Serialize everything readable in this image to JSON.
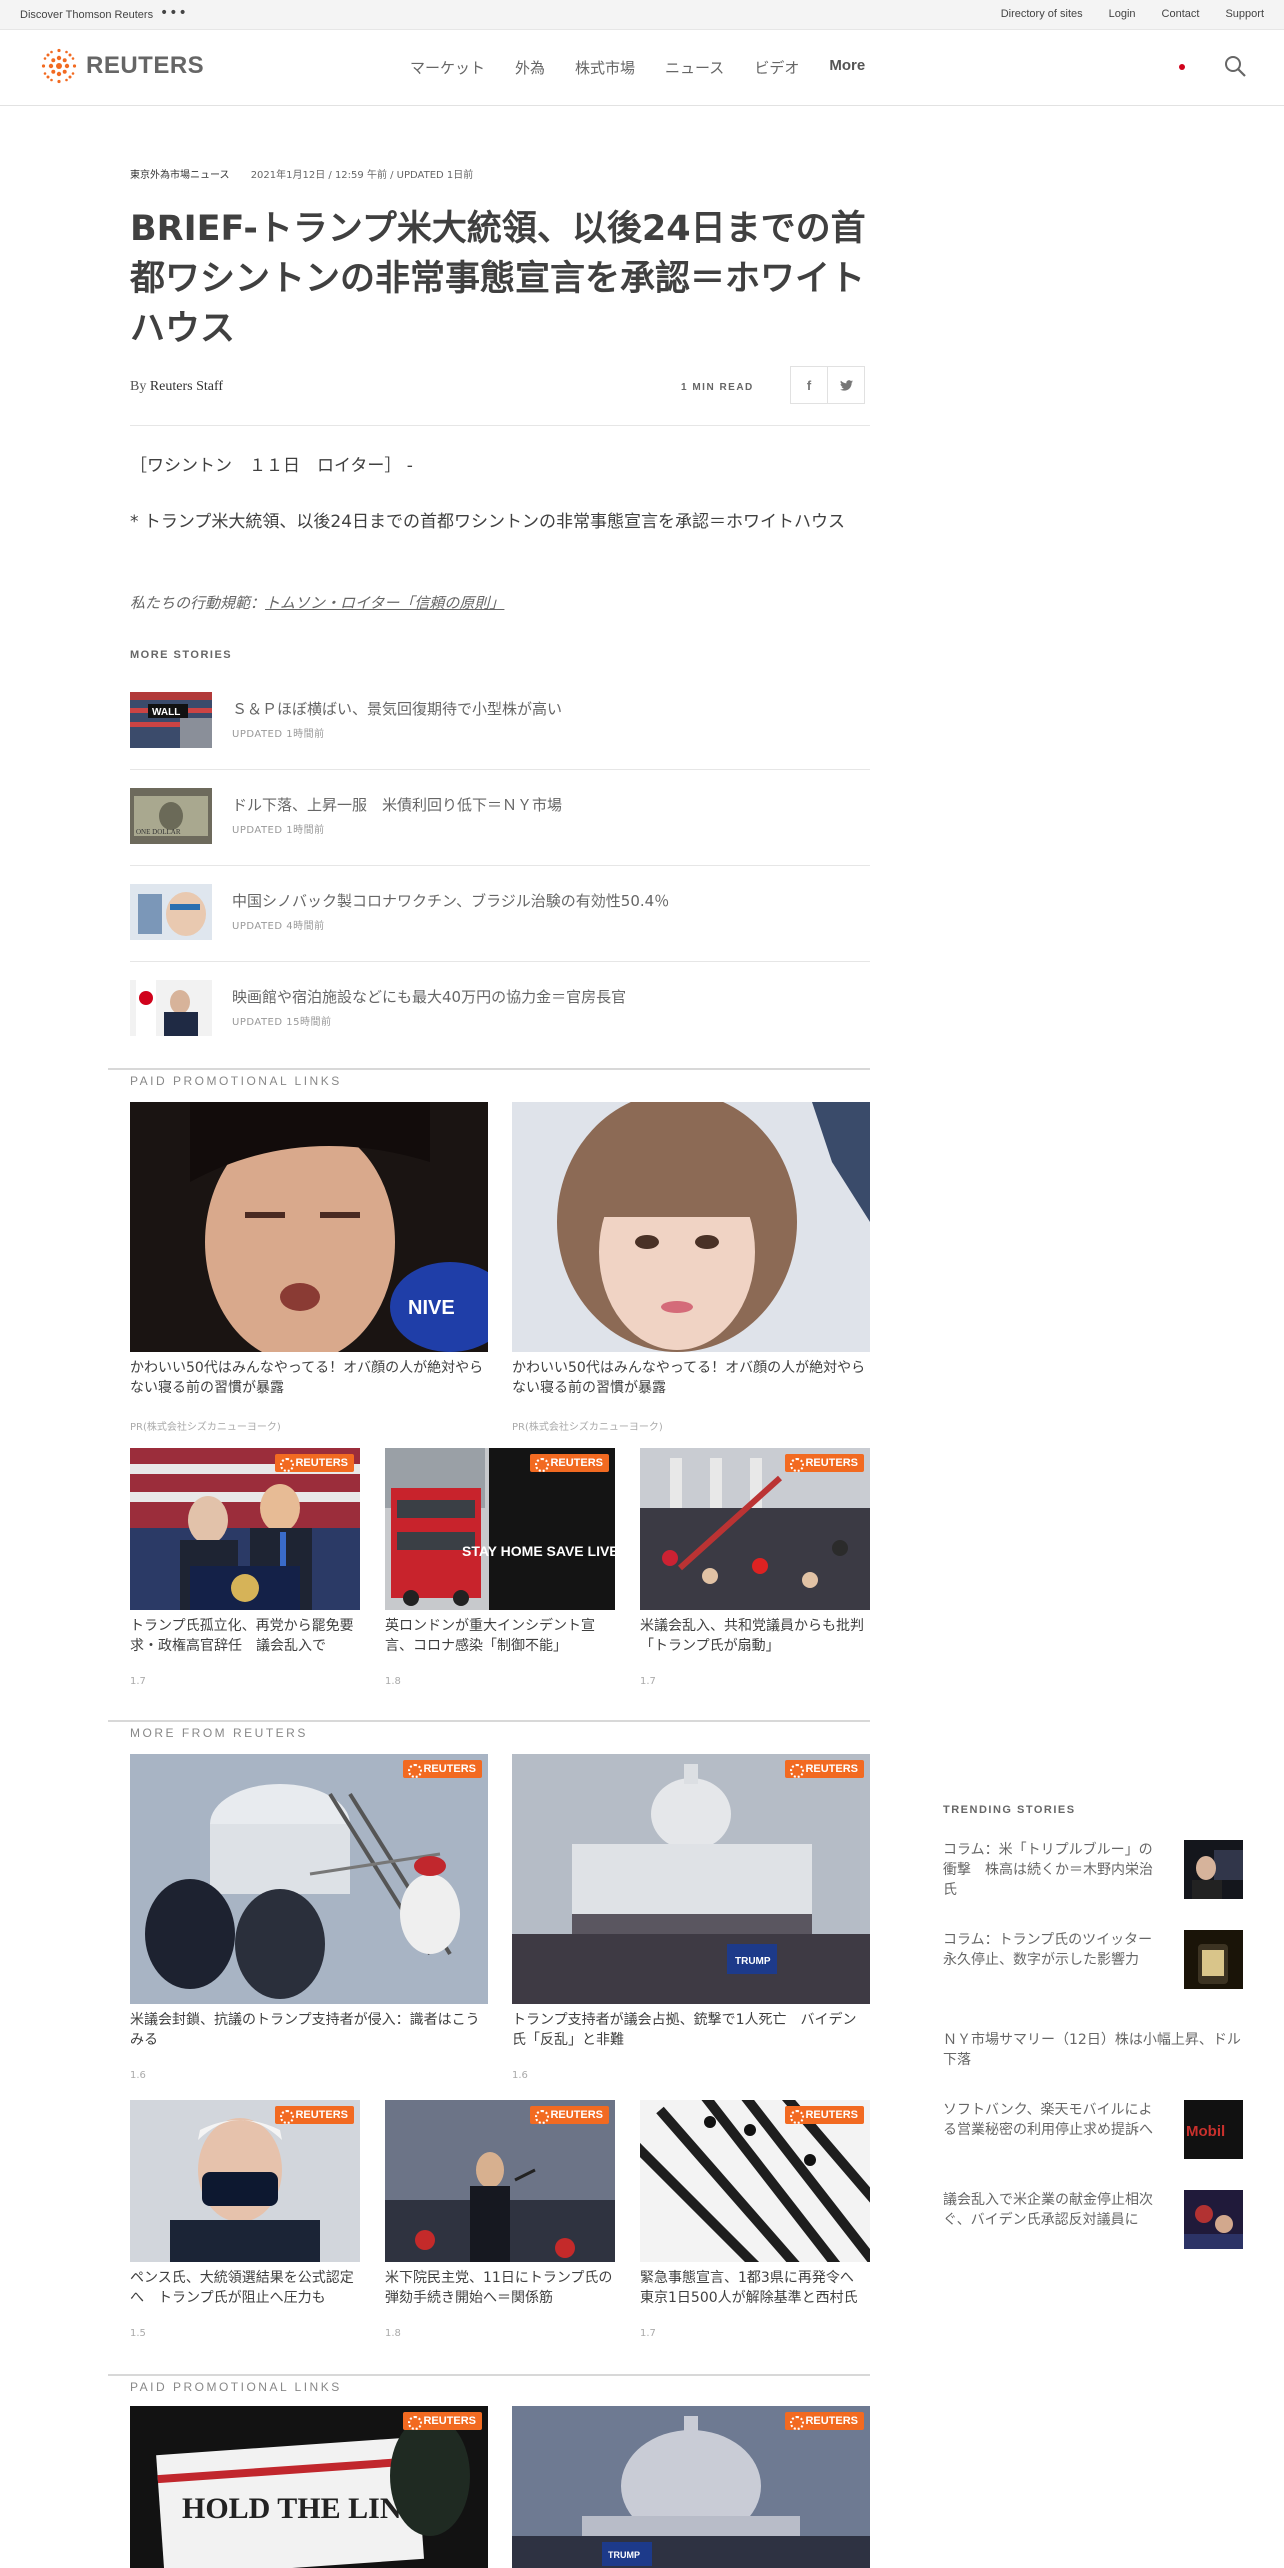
{
  "utility": {
    "discover": "Discover Thomson Reuters",
    "dots": "•••",
    "links": [
      "Directory of sites",
      "Login",
      "Contact",
      "Support"
    ]
  },
  "header": {
    "logo_text": "REUTERS",
    "nav": [
      "マーケット",
      "外為",
      "株式市場",
      "ニュース",
      "ビデオ"
    ],
    "nav_more": "More"
  },
  "article": {
    "section": "東京外為市場ニュース",
    "dateline": "2021年1月12日 / 12:59 午前 / UPDATED 1日前",
    "headline": "BRIEF-トランプ米大統領、以後24日までの首都ワシントンの非常事態宣言を承認＝ホワイトハウス",
    "by_prefix": "By",
    "author": "Reuters Staff",
    "read_time": "1 MIN READ",
    "share_fb": "f",
    "share_tw": "t",
    "para1": "［ワシントン　１１日　ロイター］ -",
    "para2": "* トランプ米大統領、以後24日までの首都ワシントンの非常事態宣言を承認＝ホワイトハウス",
    "conduct_prefix": "私たちの行動規範：",
    "conduct_link": "トムソン・ロイター「信頼の原則」"
  },
  "more_stories": {
    "label": "MORE STORIES",
    "items": [
      {
        "title": "Ｓ＆Ｐほぼ横ばい、景気回復期待で小型株が高い",
        "time": "UPDATED 1時間前",
        "thumb_label": "WALL"
      },
      {
        "title": "ドル下落、上昇一服　米債利回り低下＝ＮＹ市場",
        "time": "UPDATED 1時間前",
        "thumb_label": "ONE DOLLAR"
      },
      {
        "title": "中国シノバック製コロナワクチン、ブラジル治験の有効性50.4％",
        "time": "UPDATED 4時間前",
        "thumb_label": ""
      },
      {
        "title": "映画館や宿泊施設などにも最大40万円の協力金＝官房長官",
        "time": "UPDATED 15時間前",
        "thumb_label": ""
      }
    ]
  },
  "promo1": {
    "label": "PAID PROMOTIONAL LINKS",
    "big": [
      {
        "caption": "かわいい50代はみんなやってる！オバ顔の人が絶対やらない寝る前の習慣が暴露",
        "source": "PR(株式会社シズカニューヨーク)",
        "img_text": "NIVE"
      },
      {
        "caption": "かわいい50代はみんなやってる！オバ顔の人が絶対やらない寝る前の習慣が暴露",
        "source": "PR(株式会社シズカニューヨーク)",
        "img_text": ""
      }
    ],
    "small": [
      {
        "caption": "トランプ氏孤立化、再党から罷免要求・政権高官辞任　議会乱入で",
        "date": "1.7",
        "badge": "REUTERS",
        "img_text": ""
      },
      {
        "caption": "英ロンドンが重大インシデント宣言、コロナ感染「制御不能」",
        "date": "1.8",
        "badge": "REUTERS",
        "img_text": "STAY HOME SAVE LIVES"
      },
      {
        "caption": "米議会乱入、共和党議員からも批判　「トランプ氏が扇動」",
        "date": "1.7",
        "badge": "REUTERS",
        "img_text": ""
      }
    ]
  },
  "more_from": {
    "label": "MORE FROM REUTERS",
    "big": [
      {
        "caption": "米議会封鎖、抗議のトランプ支持者が侵入：識者はこうみる",
        "date": "1.6",
        "badge": "REUTERS"
      },
      {
        "caption": "トランプ支持者が議会占拠、銃撃で1人死亡　バイデン氏「反乱」と非難",
        "date": "1.6",
        "badge": "REUTERS",
        "img_text": "TRUMP"
      }
    ],
    "small": [
      {
        "caption": "ペンス氏、大統領選結果を公式認定へ　トランプ氏が阻止へ圧力も",
        "date": "1.5",
        "badge": "REUTERS"
      },
      {
        "caption": "米下院民主党、11日にトランプ氏の弾劾手続き開始へ＝関係筋",
        "date": "1.8",
        "badge": "REUTERS"
      },
      {
        "caption": "緊急事態宣言、1都3県に再発令へ　東京1日500人が解除基準と西村氏",
        "date": "1.7",
        "badge": "REUTERS"
      }
    ]
  },
  "promo2": {
    "label": "PAID PROMOTIONAL LINKS",
    "items": [
      {
        "badge": "REUTERS",
        "img_text": "HOLD THE LINE"
      },
      {
        "badge": "REUTERS",
        "img_text": "TRUMP"
      }
    ]
  },
  "trending": {
    "label": "TRENDING STORIES",
    "items": [
      {
        "title": "コラム：米「トリプルブルー」の衝撃　株高は続くか＝木野内栄治氏"
      },
      {
        "title": "コラム：トランプ氏のツイッター永久停止、数字が示した影響力"
      },
      {
        "title": "ＮＹ市場サマリー（12日）株は小幅上昇、ドル下落"
      },
      {
        "title": "ソフトバンク、楽天モバイルによる営業秘密の利用停止求め提訴へ",
        "img_text": "Mobil"
      },
      {
        "title": "議会乱入で米企業の献金停止相次ぐ、バイデン氏承認反対議員に"
      }
    ]
  },
  "colors": {
    "accent": "#f26a21",
    "text": "#404040",
    "muted": "#999999"
  }
}
